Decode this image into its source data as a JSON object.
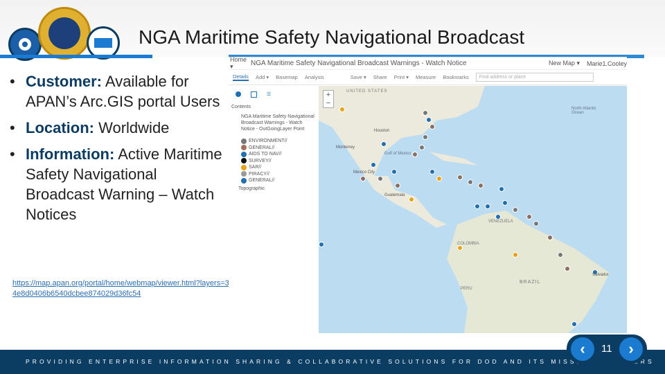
{
  "slide": {
    "title": "NGA Maritime Safety Navigational Broadcast",
    "page_number": "11",
    "bullets": [
      {
        "label": "Customer:",
        "text": " Available for APAN’s Arc.GIS portal Users"
      },
      {
        "label": "Location:",
        "text": " Worldwide"
      },
      {
        "label": "Information:",
        "text": " Active Maritime Safety Navigational Broadcast Warning – Watch Notices"
      }
    ],
    "link": "https://map.apan.org/portal/home/webmap/viewer.html?layers=34e8d0406b6540dcbee874029d36fc54",
    "footer": "PROVIDING ENTERPRISE INFORMATION SHARING & COLLABORATIVE SOLUTIONS FOR DOD AND ITS MISSION PARTNERS"
  },
  "viewer": {
    "home": "Home ▾",
    "title": "NGA Maritime Safety Navigational Broadcast Warnings - Watch Notice",
    "new_map": "New Map ▾",
    "user": "Marie1.Cooley",
    "toolbar": [
      "Details",
      "Add ▾",
      "Basemap",
      "Analysis",
      "Save ▾",
      "Share",
      "Print ▾",
      "Measure",
      "Bookmarks"
    ],
    "search_placeholder": "Find address or place",
    "contents_label": "Contents",
    "layer": "NGA Maritime Safety Navigational Broadcast Warnings - Watch Notice - OutGoingLayer Point",
    "legend": [
      {
        "label": "ENVIRONMENT//",
        "color": "#777777"
      },
      {
        "label": "GENERAL//",
        "color": "#a0705a"
      },
      {
        "label": "AIDS TO NAV//",
        "color": "#1f6fb2"
      },
      {
        "label": "SURVEY//",
        "color": "#111111"
      },
      {
        "label": "SAR//",
        "color": "#e8a317"
      },
      {
        "label": "PIRACY//",
        "color": "#999999"
      },
      {
        "label": "GENERAL//",
        "color": "#1f6fb2"
      }
    ],
    "basemap": "Topographic",
    "map_labels": [
      "UNITED STATES",
      "Houston",
      "Monterrey",
      "Mexico City",
      "Gulf of Mexico",
      "Guatemala",
      "VENEZUELA",
      "COLOMBIA",
      "BRAZIL",
      "PERU",
      "Salvador",
      "North Atlantic Ocean"
    ]
  }
}
